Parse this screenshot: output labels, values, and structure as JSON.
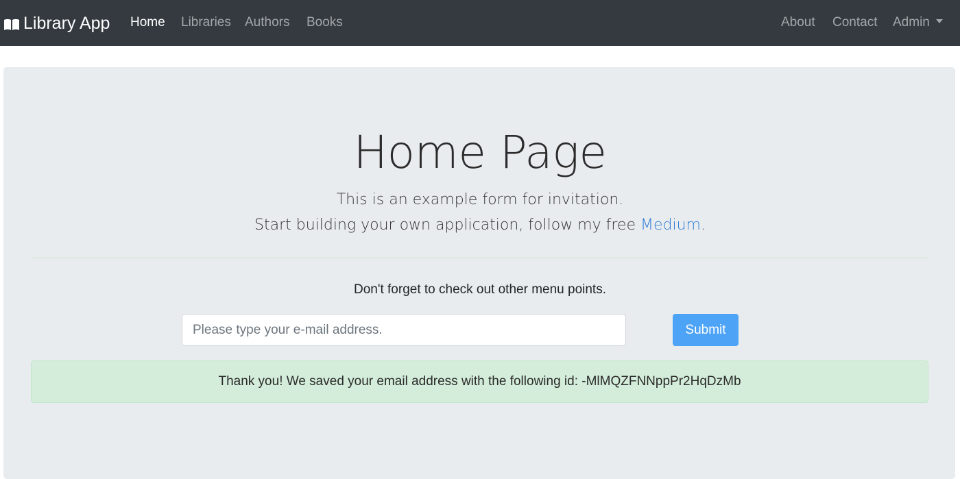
{
  "navbar": {
    "brand": "Library App",
    "brand_icon": "open-book-icon",
    "left_items": [
      {
        "label": "Home",
        "active": true
      },
      {
        "label": "Libraries"
      },
      {
        "label": "Authors"
      },
      {
        "label": "Books"
      }
    ],
    "right_items": [
      {
        "label": "About"
      },
      {
        "label": "Contact"
      },
      {
        "label": "Admin",
        "icon": "caret-down-icon"
      }
    ]
  },
  "main": {
    "title": "Home Page",
    "lead_line1": "This is an example form for invitation.",
    "lead_line2_prefix": "Start building your own application, follow my free ",
    "lead_link": "Medium",
    "lead_line2_suffix": ".",
    "note": "Don't forget to check out other menu points.",
    "email_placeholder": "Please type your e-mail address.",
    "email_value": "",
    "submit_label": "Submit",
    "alert_text": "Thank you! We saved your email address with the following id: -MlMQZFNNppPr2HqDzMb"
  },
  "colors": {
    "navbar_bg": "#343a40",
    "jumbotron_bg": "#e9ecef",
    "primary_button": "#4da3f5",
    "success_alert_bg": "#d4edda",
    "link": "#2e7cd6"
  }
}
